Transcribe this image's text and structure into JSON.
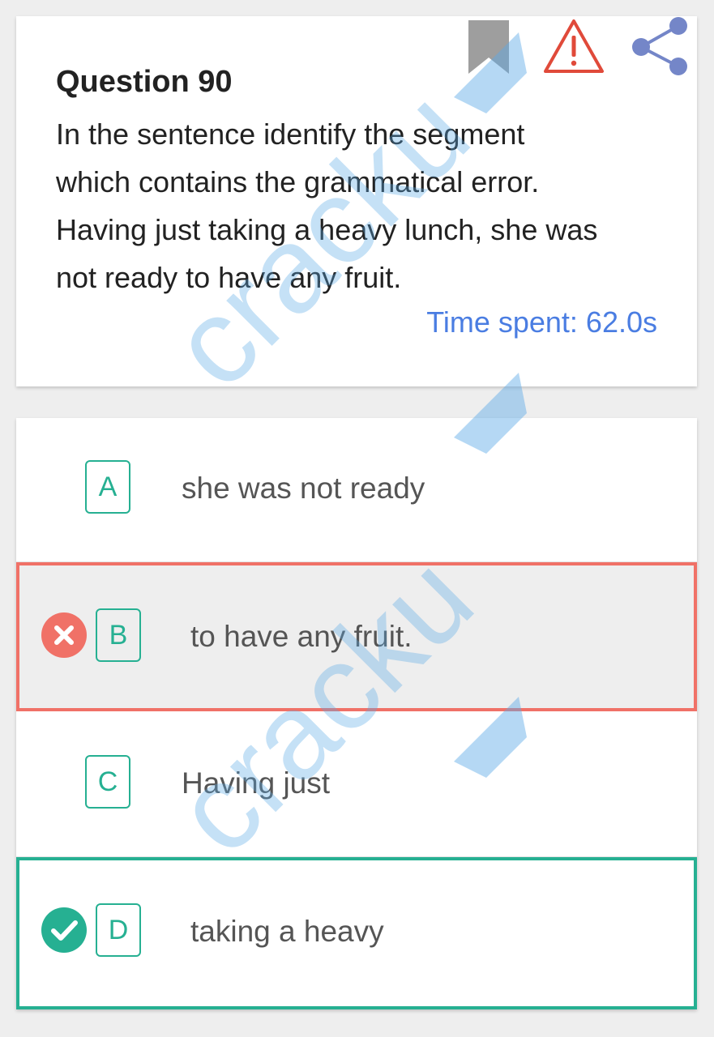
{
  "question": {
    "title": "Question 90",
    "lines": [
      "In the sentence identify the segment",
      "which contains the grammatical error.",
      "Having just taking a heavy lunch, she was",
      "not ready to have any fruit."
    ],
    "time_spent": "Time spent: 62.0s"
  },
  "icons": {
    "bookmark": "bookmark-icon",
    "report": "warning-icon",
    "share": "share-icon"
  },
  "options": [
    {
      "letter": "A",
      "text": "she was not ready",
      "state": "none"
    },
    {
      "letter": "B",
      "text": "to have any fruit.",
      "state": "wrong"
    },
    {
      "letter": "C",
      "text": "Having just",
      "state": "none"
    },
    {
      "letter": "D",
      "text": "taking a heavy",
      "state": "correct"
    }
  ],
  "colors": {
    "accent": "#26b092",
    "wrong": "#f07167",
    "time": "#4a7de2",
    "watermark": "#5aa9e6"
  },
  "watermark": "cracku"
}
